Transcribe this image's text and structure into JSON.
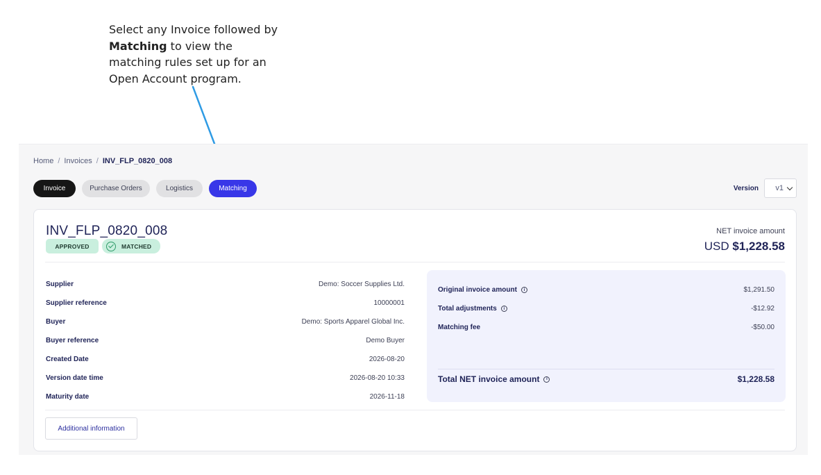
{
  "callout": {
    "line1": "Select any Invoice followed by",
    "bold": "Matching",
    "line2_rest": " to view the matching rules set up for an Open Account program."
  },
  "breadcrumb": {
    "home": "Home",
    "invoices": "Invoices",
    "current": "INV_FLP_0820_008"
  },
  "tabs": [
    {
      "label": "Invoice",
      "state": "selected-dark"
    },
    {
      "label": "Purchase Orders",
      "state": "default"
    },
    {
      "label": "Logistics",
      "state": "default"
    },
    {
      "label": "Matching",
      "state": "active"
    }
  ],
  "version": {
    "label": "Version",
    "value": "v1"
  },
  "invoice": {
    "title": "INV_FLP_0820_008",
    "badges": {
      "approved": "APPROVED",
      "matched": "MATCHED"
    },
    "net_label": "NET invoice amount",
    "net_currency": "USD",
    "net_value": "$1,228.58"
  },
  "details": [
    {
      "key": "Supplier",
      "value": "Demo: Soccer Supplies Ltd."
    },
    {
      "key": "Supplier reference",
      "value": "10000001"
    },
    {
      "key": "Buyer",
      "value": "Demo: Sports Apparel Global Inc."
    },
    {
      "key": "Buyer reference",
      "value": "Demo Buyer"
    },
    {
      "key": "Created Date",
      "value": "2026-08-20"
    },
    {
      "key": "Version date time",
      "value": "2026-08-20 10:33"
    },
    {
      "key": "Maturity date",
      "value": "2026-11-18"
    }
  ],
  "summary": {
    "original": {
      "key": "Original invoice amount",
      "value": "$1,291.50"
    },
    "adjustments": {
      "key": "Total adjustments",
      "value": "-$12.92"
    },
    "fee": {
      "key": "Matching fee",
      "value": "-$50.00"
    },
    "total": {
      "key": "Total NET invoice amount",
      "value": "$1,228.58"
    }
  },
  "buttons": {
    "additional_info": "Additional information"
  },
  "colors": {
    "accent": "#3837e8",
    "dark_tab": "#161616",
    "badge_green": "#c9efde",
    "arrow": "#2f9be4",
    "summary_bg": "#f1f2fd"
  },
  "icons": {
    "info": "info-icon",
    "check": "check-circle-icon",
    "chevron": "chevron-down-icon"
  }
}
